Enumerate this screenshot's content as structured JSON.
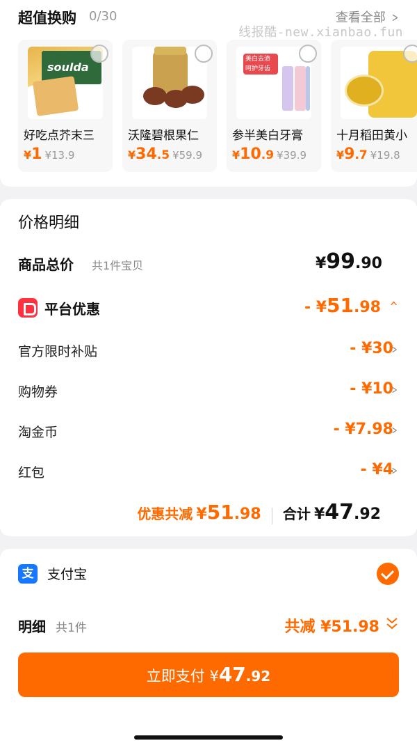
{
  "promo": {
    "title": "超值换购",
    "count": "0/30",
    "view_all": "查看全部",
    "watermark": "线报酷-new.xianbao.fun",
    "products": [
      {
        "name": "好吃点芥末三",
        "currency": "¥",
        "price_int": "1",
        "price_dec": "",
        "orig": "¥13.9"
      },
      {
        "name": "沃隆碧根果仁",
        "currency": "¥",
        "price_int": "34",
        "price_dec": ".5",
        "orig": "¥59.9"
      },
      {
        "name": "参半美白牙膏",
        "currency": "¥",
        "price_int": "10",
        "price_dec": ".9",
        "orig": "¥39.9"
      },
      {
        "name": "十月稻田黄小",
        "currency": "¥",
        "price_int": "9",
        "price_dec": ".7",
        "orig": "¥19.8"
      }
    ],
    "thumb_labels": {
      "tooth_tag": "美白去渍 呵护牙齿"
    }
  },
  "detail": {
    "title": "价格明细",
    "total": {
      "label": "商品总价",
      "sub": "共1件宝贝",
      "currency": "¥",
      "int": "99",
      "dec": ".90"
    },
    "platform": {
      "label": "平台优惠",
      "prefix": "- ¥",
      "int": "51",
      "dec": ".98"
    },
    "items": [
      {
        "label": "官方限时补贴",
        "value": "- ¥30"
      },
      {
        "label": "购物券",
        "value": "- ¥10"
      },
      {
        "label": "淘金币",
        "value": "- ¥7.98"
      },
      {
        "label": "红包",
        "value": "- ¥4"
      }
    ],
    "summary": {
      "discount_label": "优惠共减",
      "discount_currency": "¥",
      "discount_int": "51",
      "discount_dec": ".98",
      "total_label": "合计",
      "total_currency": "¥",
      "total_int": "47",
      "total_dec": ".92"
    }
  },
  "payment": {
    "method_icon": "支",
    "method": "支付宝",
    "detail_label": "明细",
    "detail_count": "共1件",
    "detail_save": "共减 ¥51.98",
    "button_label": "立即支付 ¥",
    "button_int": "47",
    "button_dec": ".92"
  },
  "colors": {
    "accent": "#ff6a00",
    "alipay": "#1677ff",
    "coupon_icon": "#ff3040"
  }
}
